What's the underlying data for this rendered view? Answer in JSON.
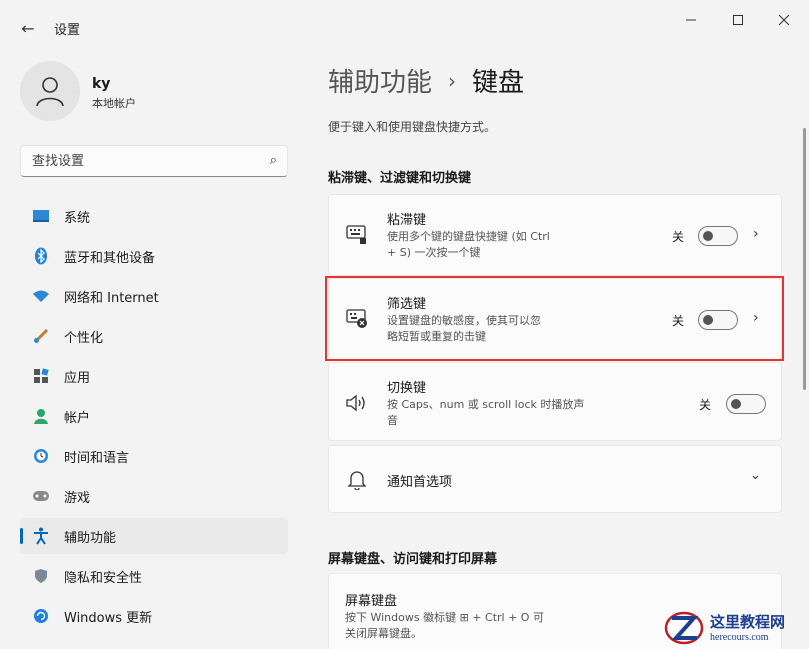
{
  "window": {
    "title": "设置",
    "back_icon": "arrow-left-icon",
    "min_icon": "minimize-icon",
    "max_icon": "maximize-icon",
    "close_icon": "close-icon"
  },
  "user": {
    "name": "ky",
    "account_type": "本地帐户"
  },
  "search": {
    "placeholder": "查找设置",
    "value": ""
  },
  "sidebar": {
    "items": [
      {
        "label": "系统",
        "icon": "monitor-icon",
        "active": false
      },
      {
        "label": "蓝牙和其他设备",
        "icon": "bluetooth-icon",
        "active": false
      },
      {
        "label": "网络和 Internet",
        "icon": "wifi-icon",
        "active": false
      },
      {
        "label": "个性化",
        "icon": "brush-icon",
        "active": false
      },
      {
        "label": "应用",
        "icon": "apps-icon",
        "active": false
      },
      {
        "label": "帐户",
        "icon": "person-icon",
        "active": false
      },
      {
        "label": "时间和语言",
        "icon": "clock-globe-icon",
        "active": false
      },
      {
        "label": "游戏",
        "icon": "gamepad-icon",
        "active": false
      },
      {
        "label": "辅助功能",
        "icon": "accessibility-icon",
        "active": true
      },
      {
        "label": "隐私和安全性",
        "icon": "shield-icon",
        "active": false
      },
      {
        "label": "Windows 更新",
        "icon": "update-icon",
        "active": false
      }
    ]
  },
  "main": {
    "breadcrumb_parent": "辅助功能",
    "breadcrumb_sep": "›",
    "breadcrumb_current": "键盘",
    "description": "便于键入和使用键盘快捷方式。",
    "section1_title": "粘滞键、过滤键和切换键",
    "sticky": {
      "title": "粘滞键",
      "desc_line1": "使用多个键的键盘快捷键 (如 Ctrl",
      "desc_line2": "+ S) 一次按一个键",
      "state": "关"
    },
    "filter": {
      "title": "筛选键",
      "desc_line1": "设置键盘的敏感度，使其可以忽",
      "desc_line2": "略短暂或重复的击键",
      "state": "关"
    },
    "toggle_keys": {
      "title": "切换键",
      "desc_line1": "按 Caps、num 或 scroll lock 时播放声",
      "desc_line2": "音",
      "state": "关"
    },
    "notify": {
      "title": "通知首选项"
    },
    "section2_title": "屏幕键盘、访问键和打印屏幕",
    "osk": {
      "title": "屏幕键盘",
      "desc_line1": "按下 Windows 徽标键 ⊞ + Ctrl + O 可",
      "desc_line2": "关闭屏幕键盘。"
    }
  },
  "watermark": {
    "cn": "这里教程网",
    "en": "herecours.com"
  },
  "colors": {
    "accent": "#0067c0",
    "highlight": "#e23636",
    "watermark": "#1e3f8f"
  }
}
